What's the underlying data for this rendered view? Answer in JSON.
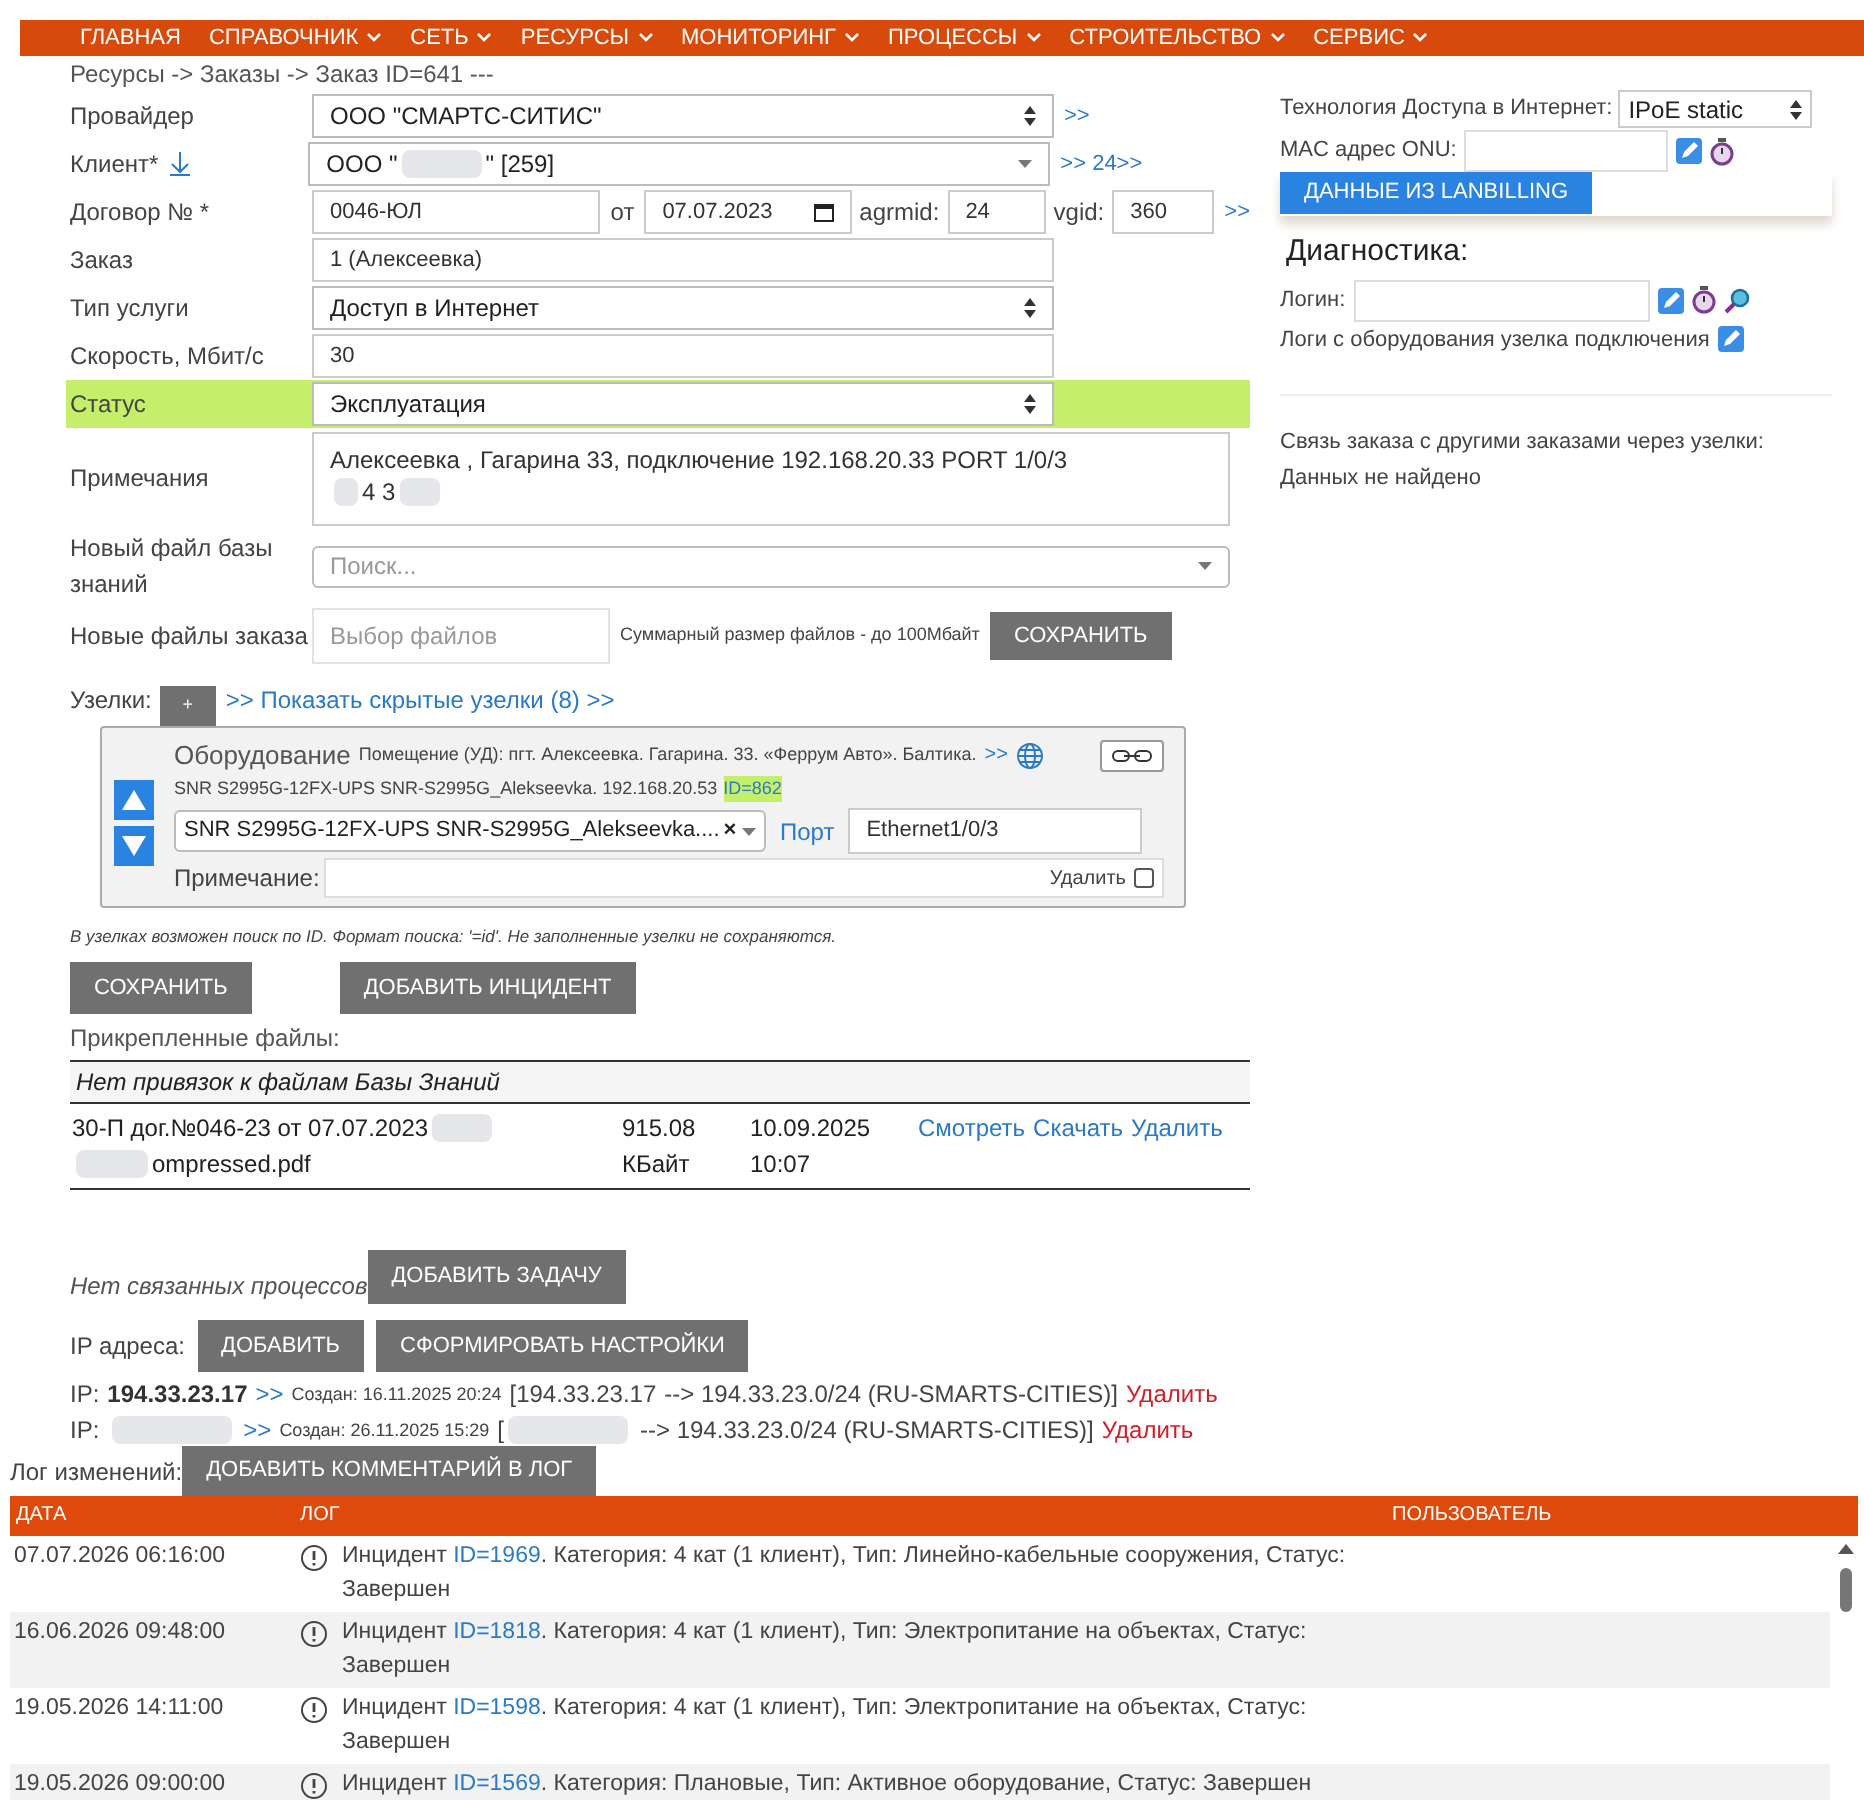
{
  "nav": [
    {
      "label": "ГЛАВНАЯ",
      "dropdown": false
    },
    {
      "label": "СПРАВОЧНИК",
      "dropdown": true
    },
    {
      "label": "СЕТЬ",
      "dropdown": true
    },
    {
      "label": "РЕСУРСЫ",
      "dropdown": true
    },
    {
      "label": "МОНИТОРИНГ",
      "dropdown": true
    },
    {
      "label": "ПРОЦЕССЫ",
      "dropdown": true
    },
    {
      "label": "СТРОИТЕЛЬСТВО",
      "dropdown": true
    },
    {
      "label": "СЕРВИС",
      "dropdown": true
    }
  ],
  "breadcrumb": "Ресурсы -> Заказы -> Заказ ID=641 ---",
  "form": {
    "provider": {
      "label": "Провайдер",
      "value": "ООО \"СМАРТС-СИТИС\"",
      "link": ">>"
    },
    "client": {
      "label": "Клиент*",
      "value_start": "ООО \"",
      "value_end": "\" [259]",
      "link": ">> 24>>"
    },
    "contract": {
      "label": "Договор № *",
      "number": "0046-ЮЛ",
      "from_label": "от",
      "date": "07.07.2023",
      "agrmid_label": "agrmid:",
      "agrmid": "24",
      "vgid_label": "vgid:",
      "vgid": "360",
      "link": ">>"
    },
    "order": {
      "label": "Заказ",
      "value": "1 (Алексеевка)"
    },
    "service": {
      "label": "Тип услуги",
      "value": "Доступ в Интернет"
    },
    "speed": {
      "label": "Скорость, Мбит/с",
      "value": "30"
    },
    "status": {
      "label": "Статус",
      "value": "Эксплуатация",
      "highlighted": true
    },
    "notes": {
      "label": "Примечания",
      "line1": "Алексеевка , Гагарина 33, подключение 192.168.20.33 PORT 1/0/3",
      "line2_visible": "4 3"
    },
    "kb_file": {
      "label": "Новый файл базы знаний",
      "placeholder": "Поиск..."
    },
    "order_files": {
      "label": "Новые файлы заказа",
      "placeholder": "Выбор файлов",
      "hint": "Суммарный размер файлов - до 100Мбайт",
      "button": "СОХРАНИТЬ"
    }
  },
  "nodes": {
    "label": "Узелки:",
    "add_button": "+",
    "show_hidden": ">> Показать скрытые узелки (8) >>",
    "card": {
      "title": "Оборудование",
      "location": "Помещение (УД): пгт. Алексеевка. Гагарина. 33. «Феррум Авто». Балтика.",
      "location_link": ">>",
      "device_line": "SNR S2995G-12FX-UPS SNR-S2995G_Alekseevka. 192.168.20.53",
      "id_tag": "ID=862",
      "device_select": "SNR S2995G-12FX-UPS SNR-S2995G_Alekseevka....",
      "clear": "×",
      "port_label": "Порт",
      "port": "Ethernet1/0/3",
      "note_label": "Примечание:",
      "delete_label": "Удалить",
      "delete_checked": false
    },
    "hint": "В узелках возможен поиск по ID. Формат поиска: '=id'. Не заполненные узелки не сохраняются."
  },
  "actions": [
    "СОХРАНИТЬ",
    "ДОБАВИТЬ ИНЦИДЕНТ"
  ],
  "attached": {
    "title": "Прикрепленные файлы:",
    "kb_note": "Нет привязок к файлам Базы Знаний",
    "files": [
      {
        "name_line1": "30-П дог.№046-23 от 07.07.2023",
        "name_line2": "ompressed.pdf",
        "size": "915.08",
        "unit": "КБайт",
        "date": "10.09.2025",
        "time": "10:07",
        "links": [
          "Смотреть",
          "Скачать",
          "Удалить"
        ]
      }
    ]
  },
  "processes": {
    "note": "Нет связанных процессов",
    "button": "ДОБАВИТЬ ЗАДАЧУ"
  },
  "ip": {
    "label": "IP адреса:",
    "buttons": [
      "ДОБАВИТЬ",
      "СФОРМИРОВАТЬ НАСТРОЙКИ"
    ],
    "items": [
      {
        "prefix": "IP:",
        "address": "194.33.23.17",
        "link": ">>",
        "created": "Создан: 16.11.2025 20:24",
        "route_start": "[194.33.23.17",
        "route_end": "--> 194.33.23.0/24 (RU-SMARTS-CITIES)]",
        "delete": "Удалить"
      },
      {
        "prefix": "IP:",
        "link": ">>",
        "created": "Создан: 26.11.2025 15:29",
        "route_start": "[",
        "route_end": "--> 194.33.23.0/24 (RU-SMARTS-CITIES)]",
        "delete": "Удалить"
      }
    ]
  },
  "right": {
    "tech_label": "Технология Доступа в Интернет:",
    "tech_value": "IPoE static",
    "mac_label": "MAC адрес ONU:",
    "lanbilling_button": "ДАННЫЕ ИЗ LANBILLING",
    "diag_title": "Диагностика:",
    "login_label": "Логин:",
    "logs_label": "Логи с оборудования узелка подключения",
    "relation_title": "Связь заказа с другими заказами через узелки:",
    "relation_value": "Данных не найдено"
  },
  "log": {
    "label": "Лог изменений:",
    "button": "ДОБАВИТЬ КОММЕНТАРИЙ В ЛОГ",
    "columns": [
      "ДАТА",
      "ЛОГ",
      "ПОЛЬЗОВАТЕЛЬ"
    ],
    "rows": [
      {
        "date": "07.07.2026 06:16:00",
        "before": "Инцидент",
        "id": "ID=1969",
        "after": ". Категория: 4 кат (1 клиент), Тип: Линейно-кабельные сооружения, Статус: Завершен"
      },
      {
        "date": "16.06.2026 09:48:00",
        "before": "Инцидент",
        "id": "ID=1818",
        "after": ". Категория: 4 кат (1 клиент), Тип: Электропитание на объектах, Статус: Завершен"
      },
      {
        "date": "19.05.2026 14:11:00",
        "before": "Инцидент",
        "id": "ID=1598",
        "after": ". Категория: 4 кат (1 клиент), Тип: Электропитание на объектах, Статус: Завершен"
      },
      {
        "date": "19.05.2026 09:00:00",
        "before": "Инцидент",
        "id": "ID=1569",
        "after": ". Категория: Плановые, Тип: Активное оборудование, Статус: Завершен"
      }
    ]
  }
}
